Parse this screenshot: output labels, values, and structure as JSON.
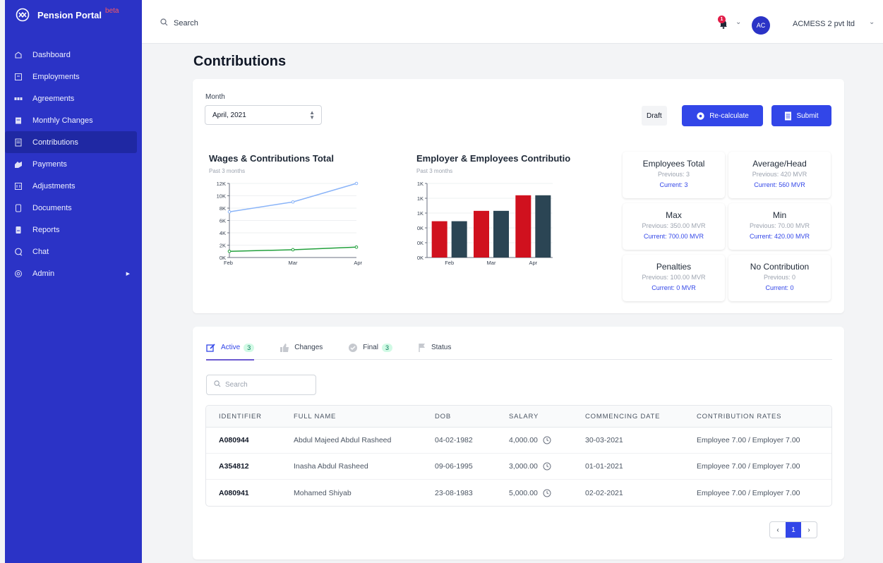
{
  "app": {
    "name": "Pension Portal",
    "beta": "beta"
  },
  "sidebar": {
    "items": [
      {
        "label": "Dashboard",
        "icon": "dashboard-icon"
      },
      {
        "label": "Employments",
        "icon": "employments-icon"
      },
      {
        "label": "Agreements",
        "icon": "agreements-icon"
      },
      {
        "label": "Monthly Changes",
        "icon": "monthly-changes-icon"
      },
      {
        "label": "Contributions",
        "icon": "contributions-icon",
        "active": true
      },
      {
        "label": "Payments",
        "icon": "payments-icon"
      },
      {
        "label": "Adjustments",
        "icon": "adjustments-icon"
      },
      {
        "label": "Documents",
        "icon": "documents-icon"
      },
      {
        "label": "Reports",
        "icon": "reports-icon"
      },
      {
        "label": "Chat",
        "icon": "chat-icon"
      },
      {
        "label": "Admin",
        "icon": "admin-icon"
      }
    ]
  },
  "topbar": {
    "search_label": "Search",
    "notification_count": "1",
    "avatar_initials": "AC",
    "organization": "ACMESS 2 pvt ltd"
  },
  "page": {
    "title": "Contributions"
  },
  "filters": {
    "month_label": "Month",
    "month_value": "April, 2021"
  },
  "actions": {
    "status": "Draft",
    "recalculate": "Re-calculate",
    "submit": "Submit"
  },
  "colors": {
    "primary": "#3246e8",
    "sidebar": "#2b33c6",
    "wages_line": "#8ab4f8",
    "contrib_line": "#22a03c",
    "employer_bar": "#d0111e",
    "employee_bar": "#2b4554"
  },
  "charts": {
    "wages": {
      "title": "Wages & Contributions Total",
      "subtitle": "Past 3 months"
    },
    "employer": {
      "title": "Employer & Employees Contributio",
      "subtitle": "Past 3 months"
    }
  },
  "chart_data": [
    {
      "type": "line",
      "title": "Wages & Contributions Total",
      "subtitle": "Past 3 months",
      "categories": [
        "Feb",
        "Mar",
        "Apr"
      ],
      "yticks": [
        "0K",
        "2K",
        "4K",
        "6K",
        "8K",
        "10K",
        "12K"
      ],
      "ylim": [
        0,
        12000
      ],
      "series": [
        {
          "values": [
            7400,
            9000,
            12000
          ],
          "color": "#8ab4f8"
        },
        {
          "values": [
            1000,
            1260,
            1680
          ],
          "color": "#22a03c"
        }
      ]
    },
    {
      "type": "bar",
      "title": "Employer & Employees Contributio",
      "subtitle": "Past 3 months",
      "categories": [
        "Feb",
        "Mar",
        "Apr"
      ],
      "yticks": [
        "0K",
        "0K",
        "0K",
        "1K",
        "1K",
        "1K"
      ],
      "ylim": [
        0,
        1000
      ],
      "series": [
        {
          "values": [
            490,
            630,
            840
          ],
          "color": "#d0111e"
        },
        {
          "values": [
            490,
            630,
            840
          ],
          "color": "#2b4554"
        }
      ]
    }
  ],
  "stats": [
    {
      "title": "Employees Total",
      "previous": "Previous: 3",
      "current": "Current: 3"
    },
    {
      "title": "Average/Head",
      "previous": "Previous: 420 MVR",
      "current": "Current: 560 MVR"
    },
    {
      "title": "Max",
      "previous": "Previous: 350.00 MVR",
      "current": "Current: 700.00 MVR"
    },
    {
      "title": "Min",
      "previous": "Previous: 70.00 MVR",
      "current": "Current: 420.00 MVR"
    },
    {
      "title": "Penalties",
      "previous": "Previous: 100.00 MVR",
      "current": "Current: 0 MVR"
    },
    {
      "title": "No Contribution",
      "previous": "Previous: 0",
      "current": "Current: 0"
    }
  ],
  "tabs": [
    {
      "label": "Active",
      "count": "3"
    },
    {
      "label": "Changes",
      "count": ""
    },
    {
      "label": "Final",
      "count": "3"
    },
    {
      "label": "Status",
      "count": ""
    }
  ],
  "table": {
    "search_placeholder": "Search",
    "columns": [
      "IDENTIFIER",
      "FULL NAME",
      "DOB",
      "SALARY",
      "COMMENCING DATE",
      "CONTRIBUTION RATES"
    ],
    "rows": [
      {
        "id": "A080944",
        "name": "Abdul Majeed Abdul Rasheed",
        "dob": "04-02-1982",
        "salary": "4,000.00",
        "commencing": "30-03-2021",
        "rates": "Employee 7.00 / Employer 7.00"
      },
      {
        "id": "A354812",
        "name": "Inasha Abdul Rasheed",
        "dob": "09-06-1995",
        "salary": "3,000.00",
        "commencing": "01-01-2021",
        "rates": "Employee 7.00 / Employer 7.00"
      },
      {
        "id": "A080941",
        "name": "Mohamed Shiyab",
        "dob": "23-08-1983",
        "salary": "5,000.00",
        "commencing": "02-02-2021",
        "rates": "Employee 7.00 / Employer 7.00"
      }
    ]
  },
  "pagination": {
    "prev": "‹",
    "current": "1",
    "next": "›"
  }
}
